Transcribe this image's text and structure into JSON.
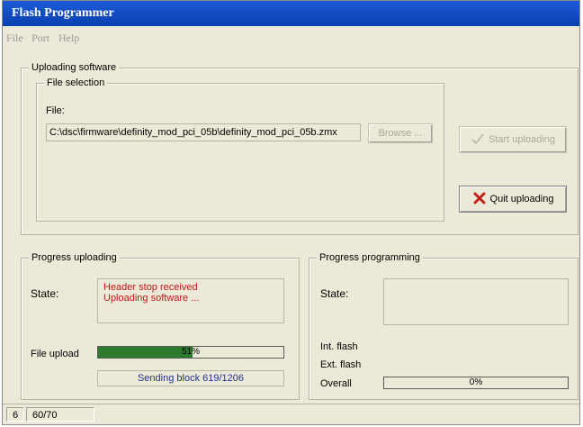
{
  "window": {
    "title": "Flash Programmer"
  },
  "menu": {
    "file": "File",
    "port": "Port",
    "help": "Help"
  },
  "uploading": {
    "group_title": "Uploading software",
    "file_selection_title": "File selection",
    "file_label": "File:",
    "file_path": "C:\\dsc\\firmware\\definity_mod_pci_05b\\definity_mod_pci_05b.zmx",
    "browse_label": "Browse ...",
    "start_label": "Start uploading",
    "quit_label": "Quit uploading"
  },
  "progress_uploading": {
    "group_title": "Progress uploading",
    "state_label": "State:",
    "state_line1": "Header stop received",
    "state_line2": "Uploading software ...",
    "file_upload_label": "File upload",
    "file_upload_percent_text": "51%",
    "file_upload_fraction": 0.51,
    "status_text": "Sending block 619/1206"
  },
  "progress_programming": {
    "group_title": "Progress programming",
    "state_label": "State:",
    "int_flash_label": "Int. flash",
    "ext_flash_label": "Ext. flash",
    "overall_label": "Overall",
    "overall_percent_text": "0%",
    "overall_fraction": 0
  },
  "statusbar": {
    "cell1": "6",
    "cell2": "60/70"
  },
  "colors": {
    "title_bar": "#1c5bd6",
    "window_bg": "#ece9d8",
    "state_text_red": "#c01818",
    "status_blue": "#1f2f8f",
    "progress_green": "#2c7a2c",
    "quit_icon_red": "#c0201c"
  }
}
